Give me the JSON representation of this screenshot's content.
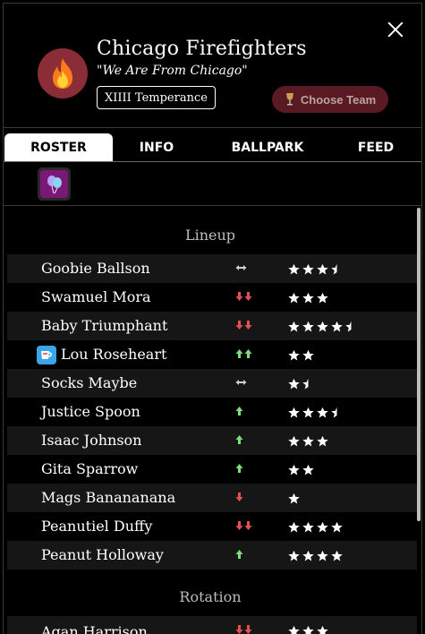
{
  "team": {
    "name": "Chicago Firefighters",
    "slogan": "\"We Are From Chicago\"",
    "emoji": "fire-emoji",
    "emoji_bg": "#8b2d37",
    "mod_badge": "XIIII Temperance",
    "choose_button": "Choose Team",
    "choose_icon": "wine-glass-icon"
  },
  "tabs": [
    {
      "label": "ROSTER",
      "active": true
    },
    {
      "label": "INFO",
      "active": false
    },
    {
      "label": "BALLPARK",
      "active": false
    },
    {
      "label": "FEED",
      "active": false
    }
  ],
  "team_item_icon": "balloons-icon",
  "sections": {
    "lineup_title": "Lineup",
    "rotation_title": "Rotation"
  },
  "lineup": [
    {
      "name": "Goobie Ballson",
      "trend": "neutral",
      "stars": 3.5,
      "item": null
    },
    {
      "name": "Swamuel Mora",
      "trend": "down2",
      "stars": 3,
      "item": null
    },
    {
      "name": "Baby Triumphant",
      "trend": "down2",
      "stars": 4.5,
      "item": null
    },
    {
      "name": "Lou Roseheart",
      "trend": "up2",
      "stars": 2,
      "item": "coffee-cup-icon"
    },
    {
      "name": "Socks Maybe",
      "trend": "neutral",
      "stars": 1.5,
      "item": null
    },
    {
      "name": "Justice Spoon",
      "trend": "up1",
      "stars": 3.5,
      "item": null
    },
    {
      "name": "Isaac Johnson",
      "trend": "up1",
      "stars": 3,
      "item": null
    },
    {
      "name": "Gita Sparrow",
      "trend": "up1",
      "stars": 2,
      "item": null
    },
    {
      "name": "Mags Banananana",
      "trend": "down1",
      "stars": 1,
      "item": null
    },
    {
      "name": "Peanutiel Duffy",
      "trend": "down2",
      "stars": 4,
      "item": null
    },
    {
      "name": "Peanut Holloway",
      "trend": "up1",
      "stars": 4,
      "item": null
    }
  ],
  "rotation": [
    {
      "name": "Agan Harrison",
      "trend": "down2",
      "stars": 3,
      "item": null
    }
  ],
  "colors": {
    "up": "#7fdc7f",
    "down": "#e0524f",
    "neutral": "#d0d0d0",
    "choose_bg": "#5a1a24"
  }
}
